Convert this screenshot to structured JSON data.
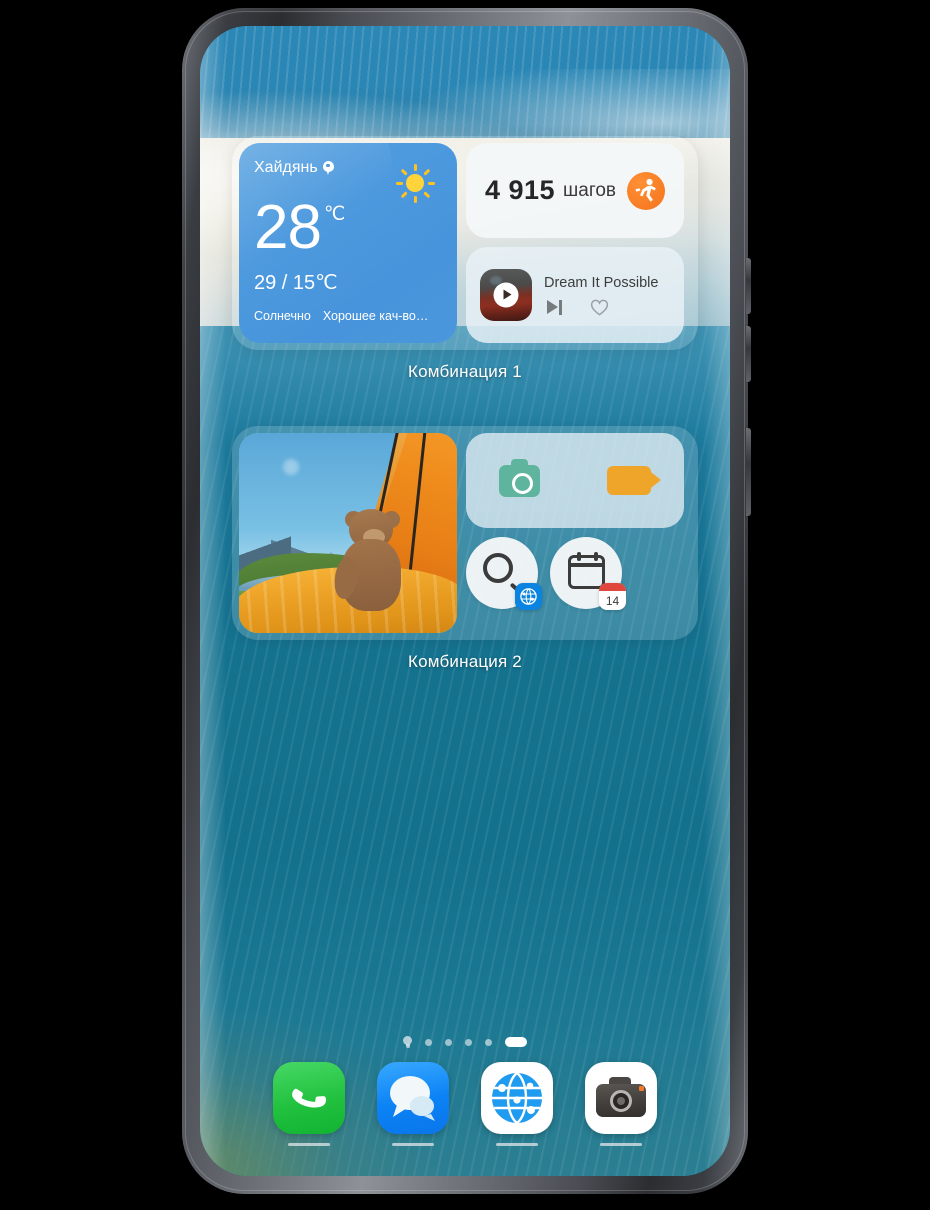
{
  "device": {
    "name": "smartphone",
    "buttons": [
      "volume-up",
      "volume-down",
      "power"
    ]
  },
  "home_screen": {
    "wallpaper_description": "Blue sea over pale dunes with teal rippled water",
    "combinations": [
      {
        "label": "Комбинация 1",
        "widgets": {
          "weather": {
            "city": "Хайдянь",
            "temperature": "28",
            "unit": "℃",
            "high_low": "29 / 15℃",
            "condition": "Солнечно",
            "air_quality": "Хорошее кач-во…",
            "icon": "sun-icon",
            "accent": "#4e9ade"
          },
          "steps": {
            "count": "4 915",
            "unit": "шагов",
            "icon": "running-icon",
            "accent": "#f4731a"
          },
          "music": {
            "title": "Dream It Possible",
            "play_icon": "play-icon",
            "next_icon": "next-track-icon",
            "favorite_icon": "heart-icon"
          }
        }
      },
      {
        "label": "Комбинация 2",
        "widgets": {
          "photo": {
            "description": "Teddy bear in orange tent overlooking mountain lake"
          },
          "shortcuts": [
            {
              "icon": "camera-icon",
              "color": "#5fb49e"
            },
            {
              "icon": "video-camera-icon",
              "color": "#efa529"
            }
          ],
          "quick_actions": [
            {
              "icon": "search-icon",
              "badge": "browser-globe-icon"
            },
            {
              "icon": "calendar-icon",
              "badge_day": "14"
            }
          ]
        }
      }
    ],
    "page_indicator": {
      "items": [
        "lightbulb-icon",
        "dot",
        "dot",
        "dot",
        "dot",
        "current-page"
      ],
      "current_index": 5
    },
    "dock": [
      {
        "name": "phone",
        "icon": "phone-icon",
        "color": "#22c23f"
      },
      {
        "name": "messages",
        "icon": "message-bubble-icon",
        "color": "#0b82f5"
      },
      {
        "name": "browser",
        "icon": "globe-icon",
        "color": "#0a84e0"
      },
      {
        "name": "camera",
        "icon": "camera-icon",
        "color": "#403d3a"
      }
    ]
  }
}
